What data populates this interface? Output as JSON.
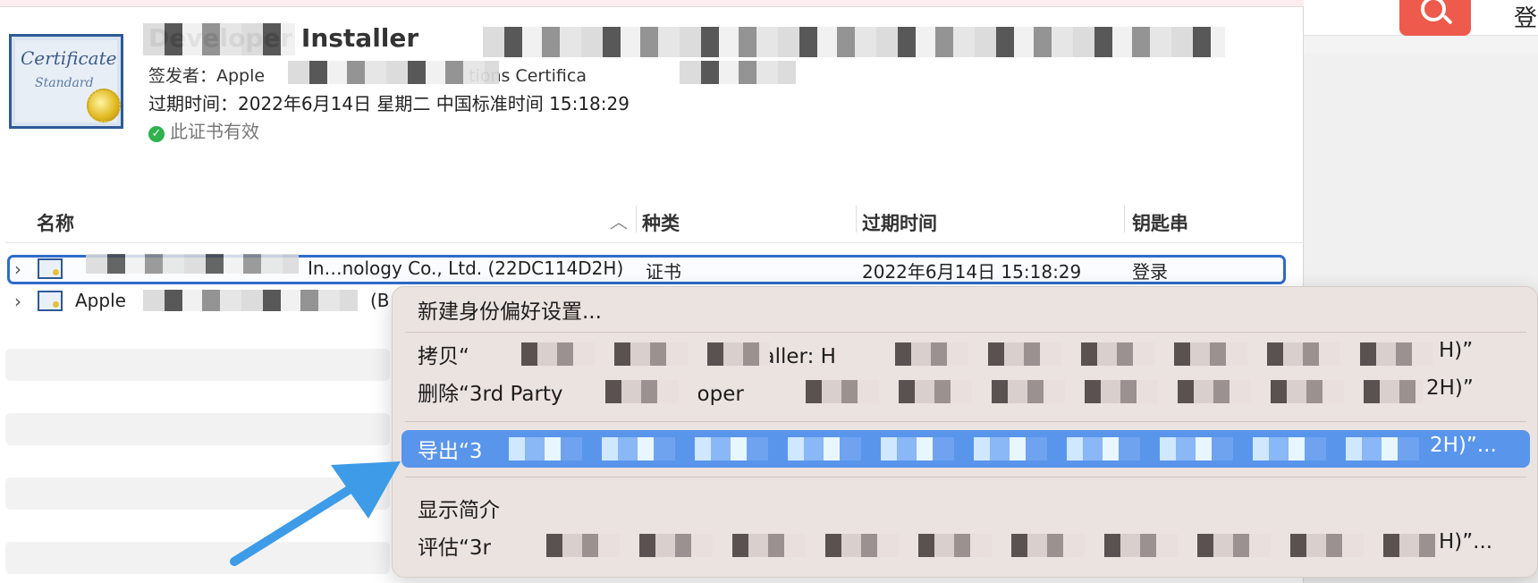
{
  "background": {
    "login_label": "登",
    "search_color": "#ee5a4b"
  },
  "certificate": {
    "title": "Developer Installer",
    "issuer_prefix": "签发者：Apple",
    "issuer_suffix": "tions Certifica",
    "expiry": "过期时间：2022年6月14日 星期二 中国标准时间 15:18:29",
    "valid": "此证书有效",
    "icon_text_1": "Certificate",
    "icon_text_2": "Standard"
  },
  "table": {
    "columns": [
      "名称",
      "种类",
      "过期时间",
      "钥匙串"
    ],
    "rows": [
      {
        "name_prefix": "",
        "name_visible": "In…nology Co., Ltd. (22DC114D2H)",
        "kind": "证书",
        "expiry": "2022年6月14日 15:18:29",
        "keychain": "登录"
      },
      {
        "name_prefix": "Apple",
        "name_visible": "(B",
        "kind": "",
        "expiry": "",
        "keychain": ""
      }
    ]
  },
  "context_menu": {
    "items": [
      {
        "label": "新建身份偏好设置..."
      },
      {
        "label_prefix": "拷贝“",
        "label_mid": "nstaller: H",
        "label_suffix": "H)”"
      },
      {
        "label_prefix": "删除“3rd Party",
        "label_mid": "oper",
        "label_suffix": "2H)”"
      },
      {
        "label_prefix": "导出“3",
        "label_suffix": "2H)”..."
      },
      {
        "label": "显示简介"
      },
      {
        "label_prefix": "评估“3r",
        "label_suffix": "H)”..."
      }
    ]
  },
  "colors": {
    "selection": "#2f6ccb",
    "highlight": "#5a95ec",
    "arrow": "#3d9be8",
    "valid": "#2fb24e"
  }
}
